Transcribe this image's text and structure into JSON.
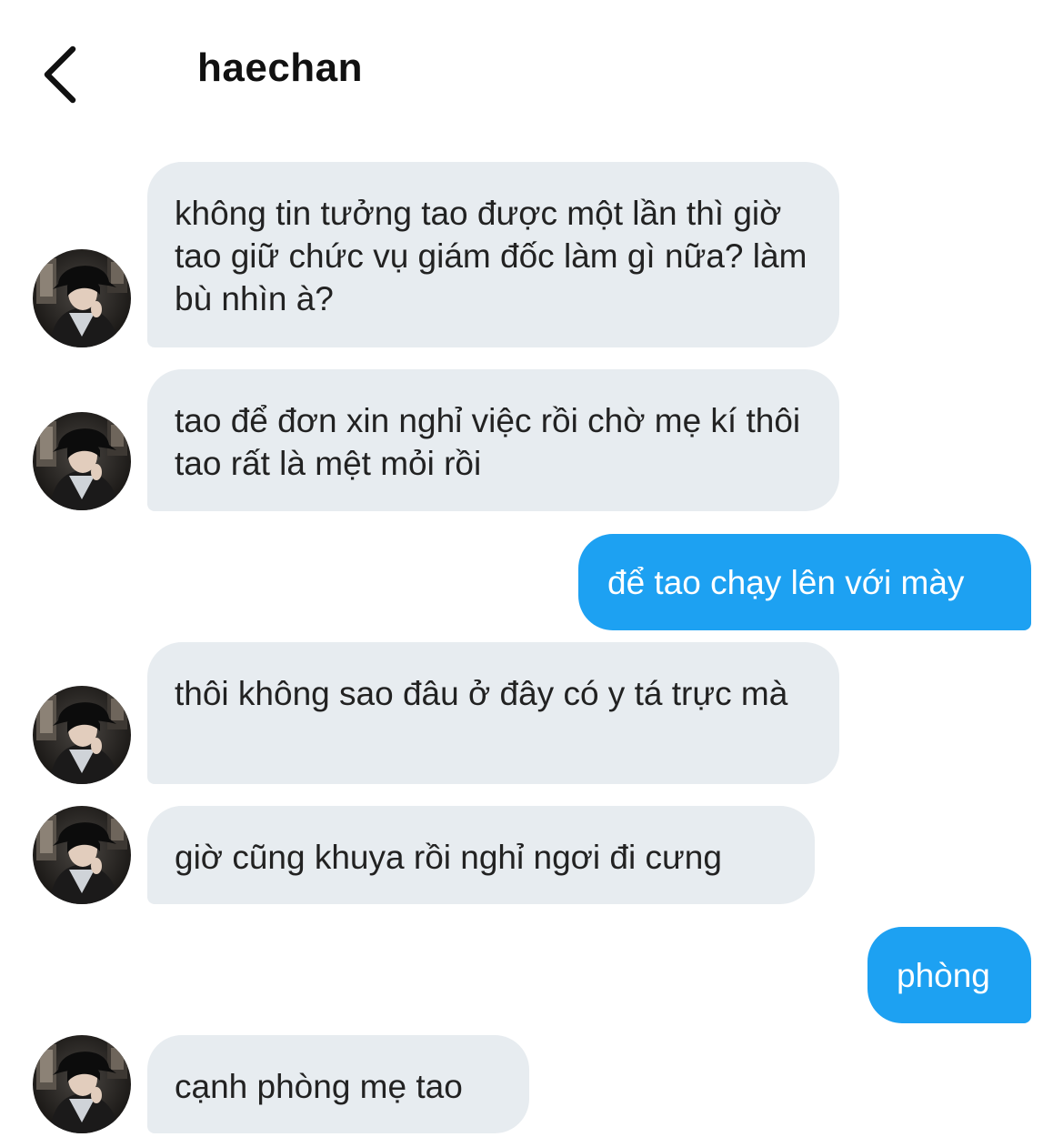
{
  "header": {
    "back_icon": "chevron-left-icon",
    "title": "haechan"
  },
  "messages": [
    {
      "sender": "them",
      "text": "không tin tưởng tao được một lần thì giờ tao giữ chức vụ giám đốc làm gì nữa? làm bù nhìn à?"
    },
    {
      "sender": "them",
      "text": "tao để đơn xin nghỉ việc rồi chờ mẹ kí thôi tao rất là mệt mỏi rồi"
    },
    {
      "sender": "me",
      "text": "để tao chạy lên với mày"
    },
    {
      "sender": "them",
      "text": "thôi không sao đâu ở đây có y tá trực mà"
    },
    {
      "sender": "them",
      "text": "giờ cũng khuya rồi nghỉ ngơi đi cưng"
    },
    {
      "sender": "me",
      "text": "phòng"
    },
    {
      "sender": "them",
      "text": "cạnh phòng mẹ tao"
    }
  ],
  "colors": {
    "incoming_bubble": "#e7ecf0",
    "outgoing_bubble": "#1da1f2",
    "outgoing_text": "#ffffff"
  }
}
